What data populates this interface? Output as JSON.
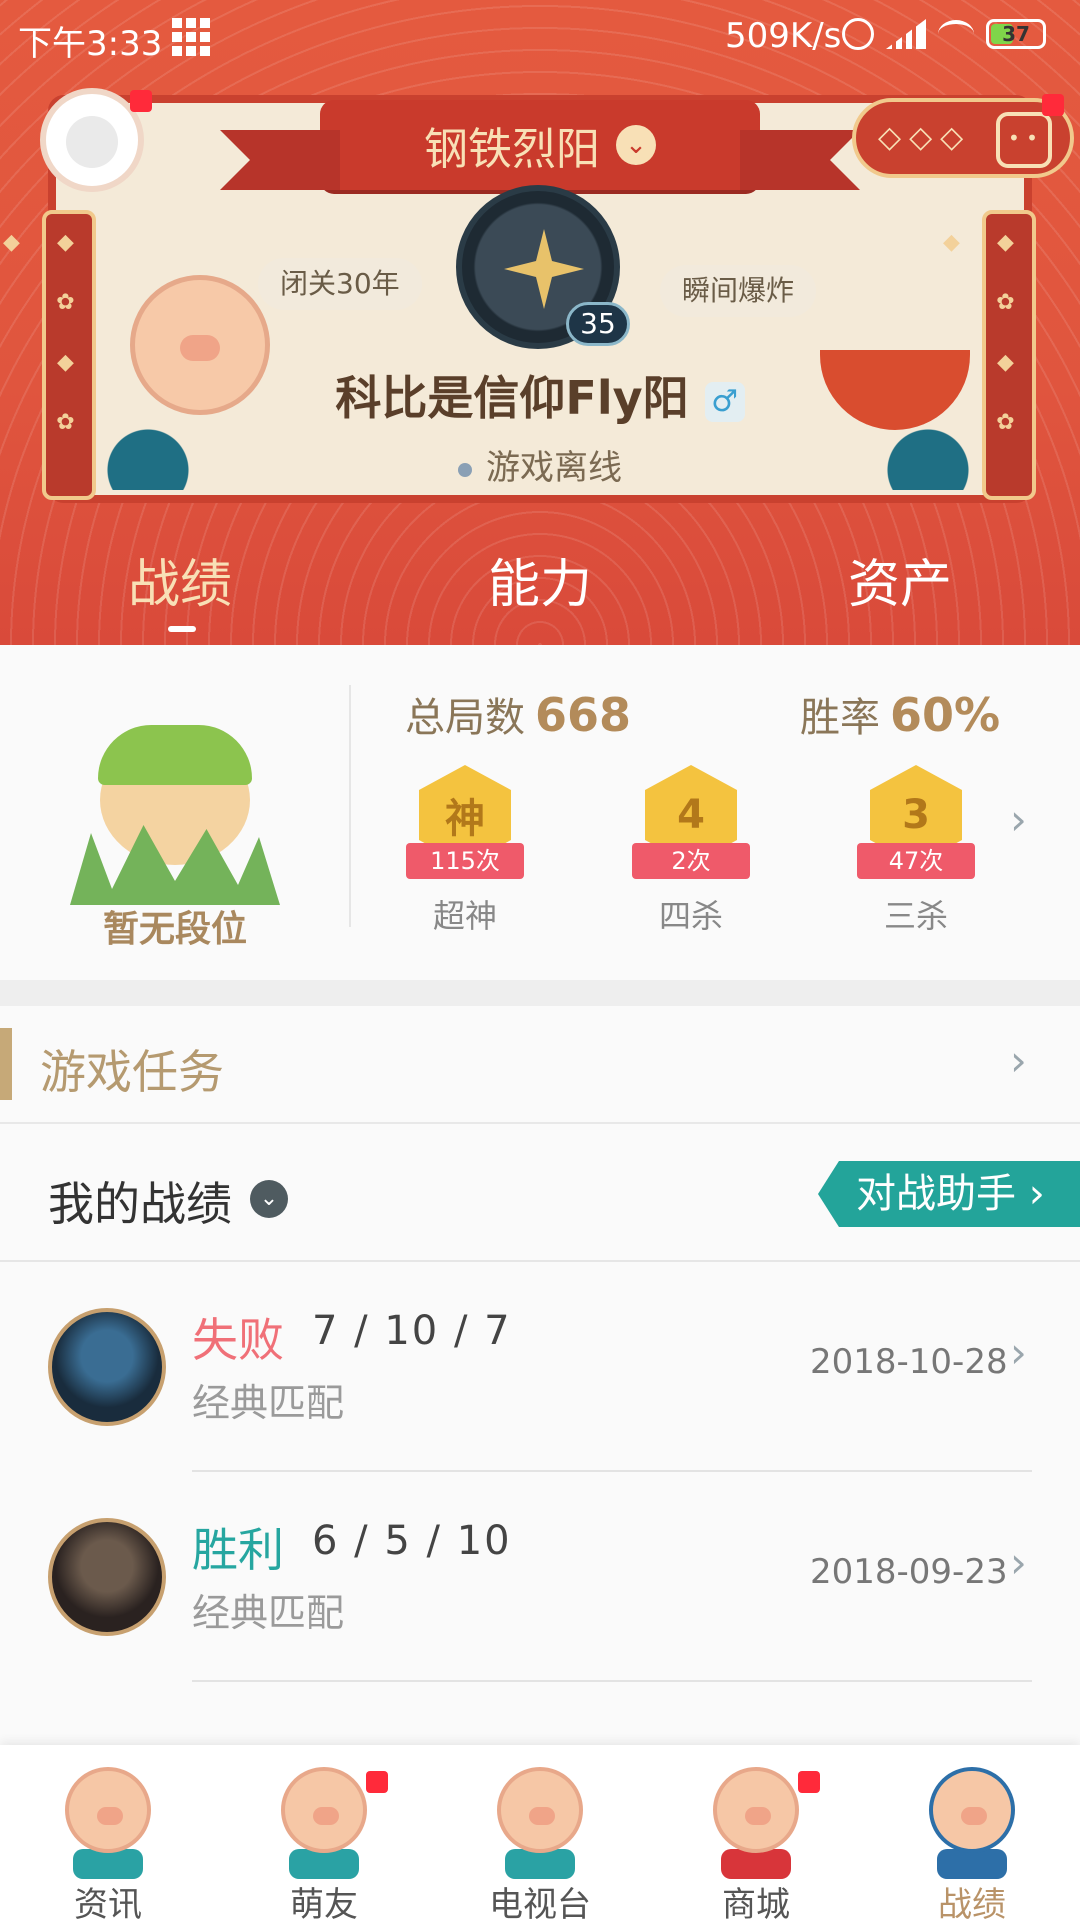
{
  "status_bar": {
    "time": "下午3:33",
    "net_speed": "509K/s",
    "battery": "37"
  },
  "header": {
    "rank_title": "钢铁烈阳",
    "level": "35",
    "tag_left": "闭关30年",
    "tag_right": "瞬间爆炸",
    "player_name": "科比是信仰Fly阳",
    "gender_symbol": "♂",
    "online_status": "游戏离线"
  },
  "tabs": [
    {
      "label": "战绩",
      "active": true
    },
    {
      "label": "能力",
      "active": false
    },
    {
      "label": "资产",
      "active": false
    }
  ],
  "stats": {
    "rank_text": "暂无段位",
    "total_games_label": "总局数",
    "total_games": "668",
    "win_rate_label": "胜率",
    "win_rate": "60%",
    "medals": [
      {
        "icon_text": "神",
        "count": "115次",
        "label": "超神"
      },
      {
        "icon_text": "4",
        "count": "2次",
        "label": "四杀"
      },
      {
        "icon_text": "3",
        "count": "47次",
        "label": "三杀"
      }
    ]
  },
  "task_section": {
    "title": "游戏任务"
  },
  "records": {
    "title": "我的战绩",
    "assistant_button": "对战助手",
    "matches": [
      {
        "result": "失败",
        "kda": "7 / 10 / 7",
        "mode": "经典匹配",
        "date": "2018-10-28",
        "outcome": "lose"
      },
      {
        "result": "胜利",
        "kda": "6 / 5 / 10",
        "mode": "经典匹配",
        "date": "2018-09-23",
        "outcome": "win"
      }
    ]
  },
  "bottom_nav": [
    {
      "label": "资讯",
      "badge": false,
      "active": false
    },
    {
      "label": "萌友",
      "badge": true,
      "active": false
    },
    {
      "label": "电视台",
      "badge": false,
      "active": false
    },
    {
      "label": "商城",
      "badge": true,
      "active": false
    },
    {
      "label": "战绩",
      "badge": false,
      "active": true
    }
  ],
  "colors": {
    "header_red": "#e0553e",
    "gold": "#b38b5a",
    "teal": "#23a49a",
    "lose_red": "#f07078",
    "win_teal": "#26a6a0"
  }
}
